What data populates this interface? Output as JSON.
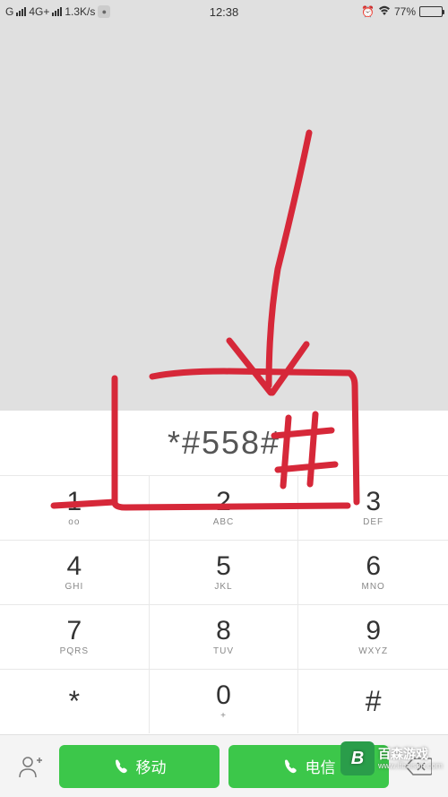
{
  "status": {
    "network": "G",
    "net_type": "4G+",
    "speed": "1.3K/s",
    "time": "12:38",
    "battery_pct": "77%",
    "battery_fill": "77%"
  },
  "dialer": {
    "entered": "*#558#",
    "keys": [
      {
        "digit": "1",
        "sub": "oo"
      },
      {
        "digit": "2",
        "sub": "ABC"
      },
      {
        "digit": "3",
        "sub": "DEF"
      },
      {
        "digit": "4",
        "sub": "GHI"
      },
      {
        "digit": "5",
        "sub": "JKL"
      },
      {
        "digit": "6",
        "sub": "MNO"
      },
      {
        "digit": "7",
        "sub": "PQRS"
      },
      {
        "digit": "8",
        "sub": "TUV"
      },
      {
        "digit": "9",
        "sub": "WXYZ"
      },
      {
        "digit": "*",
        "sub": ""
      },
      {
        "digit": "0",
        "sub": "+"
      },
      {
        "digit": "#",
        "sub": ""
      }
    ]
  },
  "call": {
    "sim1": "移动",
    "sim2": "电信"
  },
  "watermark": {
    "brand": "百森游戏",
    "url": "www.lfbaisen.com",
    "logo": "B"
  }
}
